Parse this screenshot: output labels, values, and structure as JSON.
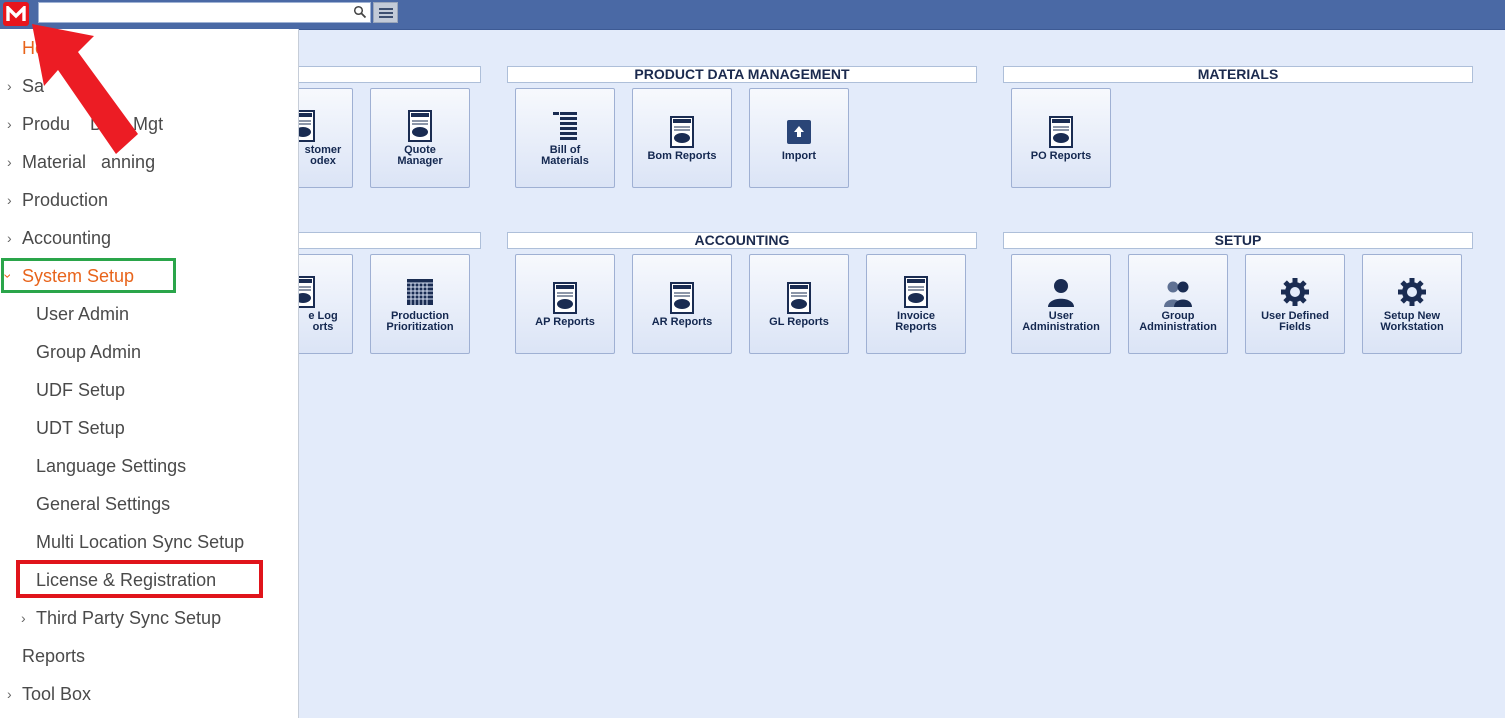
{
  "search": {
    "placeholder": ""
  },
  "sections": {
    "product_data_management": {
      "title": "PRODUCT DATA MANAGEMENT"
    },
    "materials": {
      "title": "MATERIALS"
    },
    "accounting": {
      "title": "ACCOUNTING"
    },
    "setup": {
      "title": "SETUP"
    }
  },
  "tiles": {
    "customer_rolodex": "stomer\nodex",
    "quote_manager": "Quote\nManager",
    "bill_of_materials": "Bill of\nMaterials",
    "bom_reports": "Bom Reports",
    "import": "Import",
    "po_reports": "PO Reports",
    "time_log_reports": "e Log\norts",
    "production_prioritization": "Production\nPrioritization",
    "ap_reports": "AP Reports",
    "ar_reports": "AR Reports",
    "gl_reports": "GL Reports",
    "invoice_reports": "Invoice\nReports",
    "user_administration": "User\nAdministration",
    "group_administration": "Group\nAdministration",
    "user_defined_fields": "User Defined\nFields",
    "setup_new_workstation": "Setup New\nWorkstation"
  },
  "sidebar": {
    "items": [
      {
        "label": "Home"
      },
      {
        "label": "Sa"
      },
      {
        "label": "Produ    Data Mgt"
      },
      {
        "label": "Material   anning"
      },
      {
        "label": "Production"
      },
      {
        "label": "Accounting"
      },
      {
        "label": "System Setup"
      },
      {
        "label": "User Admin"
      },
      {
        "label": "Group Admin"
      },
      {
        "label": "UDF Setup"
      },
      {
        "label": "UDT Setup"
      },
      {
        "label": "Language Settings"
      },
      {
        "label": "General Settings"
      },
      {
        "label": "Multi Location Sync Setup"
      },
      {
        "label": "License & Registration"
      },
      {
        "label": "Third Party Sync Setup"
      },
      {
        "label": "Reports"
      },
      {
        "label": "Tool Box"
      }
    ]
  },
  "colors": {
    "topbar": "#4a69a5",
    "accent_orange": "#e8641b",
    "highlight_green": "#2aa54a",
    "highlight_red": "#e0141b"
  }
}
